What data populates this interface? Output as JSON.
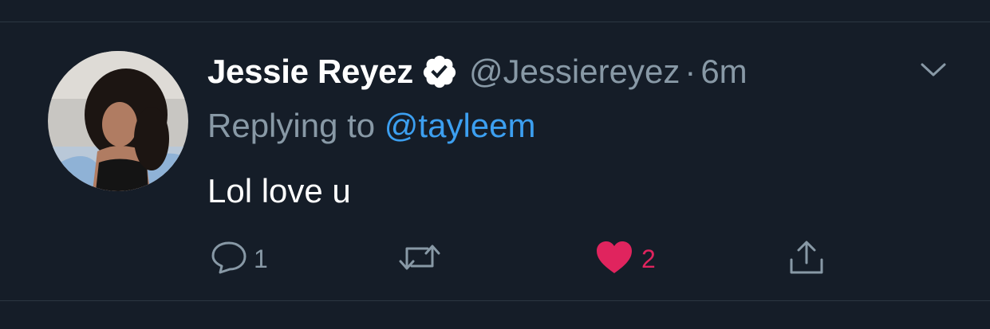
{
  "tweet": {
    "display_name": "Jessie Reyez",
    "handle": "@Jessiereyez",
    "separator": "·",
    "time": "6m",
    "replying_prefix": "Replying to",
    "replying_to": "@tayleem",
    "text": "Lol love u",
    "reply_count": "1",
    "like_count": "2"
  },
  "icons": {
    "verified": "verified-badge-icon",
    "menu": "chevron-down-icon",
    "reply": "reply-icon",
    "retweet": "retweet-icon",
    "like": "heart-icon",
    "share": "share-icon"
  },
  "colors": {
    "background": "#151d28",
    "muted_text": "#8899a6",
    "link": "#3c9ff0",
    "like": "#e0245e",
    "divider": "#2c3641"
  }
}
